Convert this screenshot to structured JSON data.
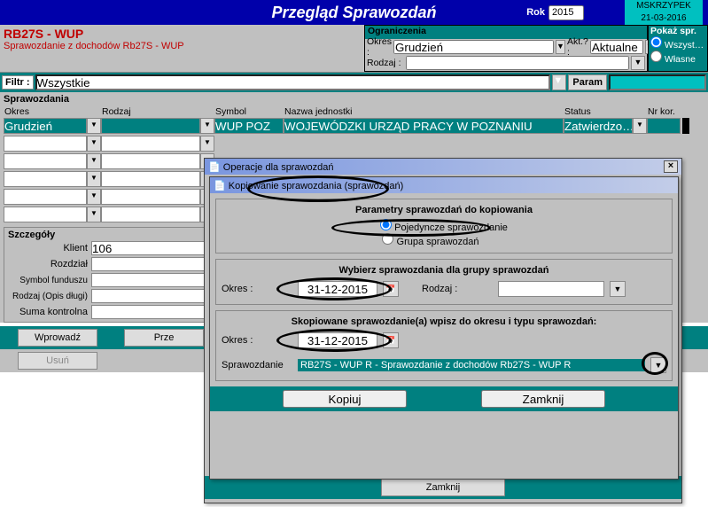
{
  "topbar": {
    "title": "Przegląd Sprawozdań",
    "rok_label": "Rok",
    "rok_value": "2015",
    "user": "MSKRZYPEK",
    "date": "21-03-2016"
  },
  "header": {
    "h1": "RB27S - WUP",
    "h2": "Sprawozdanie z dochodów Rb27S - WUP",
    "og_title": "Ograniczenia",
    "okres_label": "Okres :",
    "okres_value": "Grudzień",
    "akt_label": "Akt.? :",
    "akt_value": "Aktualne",
    "rodzaj_label": "Rodzaj :",
    "rodzaj_value": "",
    "pokaz_title": "Pokaż spr.",
    "pokaz_opt1": "Wszyst…",
    "pokaz_opt2": "Własne"
  },
  "filtr": {
    "label": "Filtr :",
    "value": "Wszystkie",
    "param_label": "Param"
  },
  "grid": {
    "title": "Sprawozdania",
    "cols": {
      "okres": "Okres",
      "rodzaj": "Rodzaj",
      "symbol": "Symbol",
      "nazwa": "Nazwa jednostki",
      "status": "Status",
      "nrkor": "Nr kor."
    },
    "row1": {
      "okres": "Grudzień",
      "rodzaj": "",
      "symbol": "WUP POZ",
      "nazwa": "WOJEWÓDZKI URZĄD PRACY W POZNANIU",
      "status": "Zatwierdzo…",
      "nrkor": ""
    }
  },
  "details": {
    "title": "Szczegóły",
    "klient_label": "Klient",
    "klient_value": "106",
    "rozdzial_label": "Rozdział",
    "symbolf_label": "Symbol funduszu",
    "rodzaj_label": "Rodzaj (Opis długi)",
    "suma_label": "Suma kontrolna"
  },
  "bottom": {
    "wprowadz": "Wprowadź",
    "prze": "Prze",
    "usun": "Usuń"
  },
  "dialog1": {
    "title": "Operacje dla sprawozdań",
    "zamknij": "Zamknij"
  },
  "dialog2": {
    "title": "Kopiowanie sprawozdania (sprawozdań)",
    "panel1_title": "Parametry sprawozdań do kopiowania",
    "opt_single": "Pojedyncze sprawozdanie",
    "opt_group": "Grupa sprawozdań",
    "panel2_title": "Wybierz sprawozdania dla grupy sprawozdań",
    "okres_label": "Okres :",
    "date1": "31-12-2015",
    "rodzaj_label": "Rodzaj :",
    "rodzaj_value": "",
    "panel3_title": "Skopiowane sprawozdanie(a) wpisz do okresu i typu sprawozdań:",
    "date2": "31-12-2015",
    "spr_label": "Sprawozdanie",
    "spr_value": "RB27S - WUP R - Sprawozdanie z dochodów Rb27S - WUP R",
    "kopiuj": "Kopiuj",
    "zamknij": "Zamknij"
  }
}
